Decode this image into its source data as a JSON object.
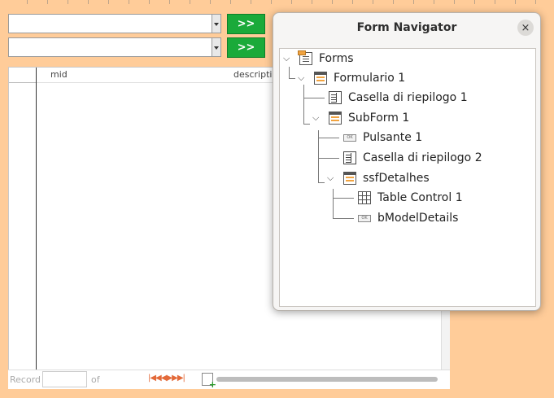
{
  "form": {
    "go_button_1": ">>",
    "go_button_2": ">>",
    "grid_columns": [
      "mid",
      "descriptio"
    ],
    "nav_record_label": "Record",
    "nav_of_label": "of"
  },
  "dialog": {
    "title": "Form Navigator",
    "close_glyph": "×"
  },
  "tree": {
    "root": "Forms",
    "formulario": "Formulario 1",
    "casella1": "Casella di riepilogo 1",
    "subform": "SubForm 1",
    "pulsante": "Pulsante 1",
    "casella2": "Casella di riepilogo 2",
    "ssf": "ssfDetalhes",
    "table": "Table Control  1",
    "bmodel": "bModelDetails"
  },
  "icons": {
    "forms": "forms-icon",
    "form": "form-icon",
    "listbox": "listbox-icon",
    "button": "push-button-icon",
    "table": "table-control-icon"
  },
  "colors": {
    "background": "#ffcc99",
    "go_button": "#1aaa3a",
    "nav_icons": "#e36a3a"
  }
}
